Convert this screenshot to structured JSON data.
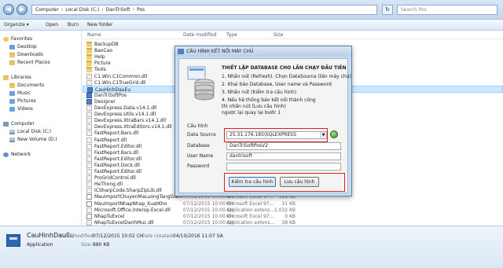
{
  "address": {
    "crumbs": [
      "Computer",
      "Local Disk (C:)",
      "DanTriSoft",
      "Pos"
    ],
    "search_placeholder": "Search Pos"
  },
  "toolbar": {
    "organize": "Organize ▾",
    "open": "Open",
    "burn": "Burn",
    "new_folder": "New folder"
  },
  "nav": {
    "favorites": "Favorites",
    "desktop": "Desktop",
    "downloads": "Downloads",
    "recent_places": "Recent Places",
    "libraries": "Libraries",
    "documents": "Documents",
    "music": "Music",
    "pictures": "Pictures",
    "videos": "Videos",
    "computer": "Computer",
    "local_disk": "Local Disk (C:)",
    "new_volume": "New Volume (D:)",
    "network": "Network"
  },
  "columns": {
    "name": "Name",
    "date": "Date modified",
    "type": "Type",
    "size": "Size"
  },
  "files": [
    {
      "name": "BackupDB",
      "date": "",
      "type": "",
      "size": "",
      "kind": "folder"
    },
    {
      "name": "BaoCao",
      "date": "",
      "type": "",
      "size": "",
      "kind": "folder"
    },
    {
      "name": "Help",
      "date": "",
      "type": "",
      "size": "",
      "kind": "folder"
    },
    {
      "name": "Picture",
      "date": "",
      "type": "",
      "size": "",
      "kind": "folder"
    },
    {
      "name": "Tools",
      "date": "",
      "type": "",
      "size": "",
      "kind": "folder"
    },
    {
      "name": "C1.Win.C1Common.dll",
      "date": "",
      "type": "",
      "size": "",
      "kind": "dll"
    },
    {
      "name": "C1.Win.C1TrueGrid.dll",
      "date": "",
      "type": "",
      "size": "",
      "kind": "dll"
    },
    {
      "name": "CauHinhDauEu",
      "date": "",
      "type": "",
      "size": "",
      "kind": "app"
    },
    {
      "name": "DanTriSoftPos",
      "date": "",
      "type": "",
      "size": "",
      "kind": "app"
    },
    {
      "name": "Designer",
      "date": "",
      "type": "",
      "size": "",
      "kind": "app"
    },
    {
      "name": "DevExpress.Data.v14.1.dll",
      "date": "",
      "type": "",
      "size": "",
      "kind": "dll"
    },
    {
      "name": "DevExpress.Utils.v14.1.dll",
      "date": "",
      "type": "",
      "size": "",
      "kind": "dll"
    },
    {
      "name": "DevExpress.XtraBars.v14.1.dll",
      "date": "",
      "type": "",
      "size": "",
      "kind": "dll"
    },
    {
      "name": "DevExpress.XtraEditors.v14.1.dll",
      "date": "",
      "type": "",
      "size": "",
      "kind": "dll"
    },
    {
      "name": "FastReport.Bars.dll",
      "date": "",
      "type": "",
      "size": "",
      "kind": "dll"
    },
    {
      "name": "FastReport.dll",
      "date": "",
      "type": "",
      "size": "",
      "kind": "dll"
    },
    {
      "name": "FastReport.Editor.dll",
      "date": "",
      "type": "",
      "size": "",
      "kind": "dll"
    },
    {
      "name": "FastReport.Bars.dll",
      "date": "",
      "type": "",
      "size": "",
      "kind": "dll"
    },
    {
      "name": "FastReport.Editor.dll",
      "date": "",
      "type": "",
      "size": "",
      "kind": "dll"
    },
    {
      "name": "FastReport.Dock.dll",
      "date": "",
      "type": "",
      "size": "",
      "kind": "dll"
    },
    {
      "name": "FastReport.Editor.dll",
      "date": "",
      "type": "",
      "size": "",
      "kind": "dll"
    },
    {
      "name": "ProGridControl.dll",
      "date": "",
      "type": "",
      "size": "",
      "kind": "dll"
    },
    {
      "name": "HeThong.dll",
      "date": "",
      "type": "",
      "size": "",
      "kind": "dll"
    },
    {
      "name": "ICSharpCode.SharpZipLib.dll",
      "date": "07/12/2015 10:00 CH",
      "type": "Application extens...",
      "size": "",
      "kind": "dll"
    },
    {
      "name": "MauImportChuyenMaLuongTangGiam",
      "date": "07/12/2015 10:00 CH",
      "type": "Microsoft Excel 97...",
      "size": "198 KB",
      "kind": "doc"
    },
    {
      "name": "MauImportNhapNhap_XuatKho",
      "date": "07/12/2015 10:00 CH",
      "type": "Microsoft Excel 97...",
      "size": "31 KB",
      "kind": "doc"
    },
    {
      "name": "Microsoft.Office.Interop.Excel.dll",
      "date": "07/12/2015 10:00 CH",
      "type": "Application extens...",
      "size": "1,032 KB",
      "kind": "dll"
    },
    {
      "name": "NhapTuExcel",
      "date": "07/12/2015 10:00 CH",
      "type": "Microsoft Excel 97...",
      "size": "0 KB",
      "kind": "doc"
    },
    {
      "name": "NhapTuExcelDanhMuc.dll",
      "date": "07/12/2015 10:00 CH",
      "type": "Application extens...",
      "size": "38 KB",
      "kind": "dll"
    }
  ],
  "details": {
    "name": "CauHinhDauEu",
    "kind": "Application",
    "modified_label": "Date modified:",
    "modified": "07/12/2015 10:02 CH",
    "size_label": "Size:",
    "size": "880 KB",
    "created_label": "Date created:",
    "created": "04/10/2016 11:07 SA"
  },
  "dialog": {
    "title": "CẤU HÌNH KẾT NỐI MÁY CHỦ",
    "heading": "THIẾT LẬP DATABASE CHO LẦN CHẠY ĐẦU TIÊN",
    "steps": [
      "1. Nhấn nút (Refresh). Chọn DataSource (tên máy chủ)",
      "2. Khai báo Database, User name và Password",
      "3. Nhấn nút (Kiểm tra cấu hình)",
      "4. Nếu hệ thống báo kết nối thành công",
      "   thì nhấn nút (Lưu cấu hình)",
      "   ngược lại quay lại bước 1"
    ],
    "section": "Cấu hình",
    "datasource_label": "Data Source",
    "datasource_value": "25.31.176.185\\SQLEXPRESS",
    "database_label": "Database",
    "database_value": "DanTriSoftPosV2",
    "username_label": "User Name",
    "username_value": "dantrisoft",
    "password_label": "Password",
    "password_value": "",
    "check_button": "Kiểm tra cấu hình",
    "save_button": "Lưu cấu hình"
  }
}
